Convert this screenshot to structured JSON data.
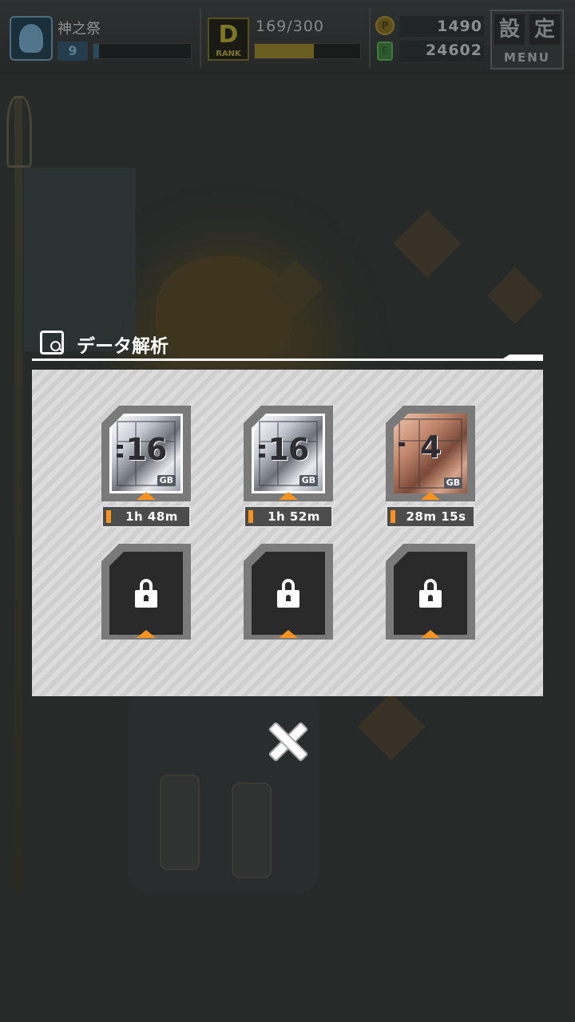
{
  "hud": {
    "player_name": "神之祭",
    "level": "9",
    "xp_fraction": 0.06,
    "rank_letter": "D",
    "rank_label": "RANK",
    "stamina_text": "169/300",
    "stamina_fraction": 0.563,
    "coins": "1490",
    "coin_icon_label": "P",
    "gems": "24602",
    "gem_icon_label": "E",
    "menu_jp_1": "設",
    "menu_jp_2": "定",
    "menu_en": "MENU"
  },
  "dialog": {
    "title": "データ解析",
    "slots": [
      {
        "type": "silver",
        "capacity": "16",
        "unit": "GB",
        "timer": "1h 48m",
        "locked": false
      },
      {
        "type": "silver",
        "capacity": "16",
        "unit": "GB",
        "timer": "1h 52m",
        "locked": false
      },
      {
        "type": "bronze",
        "capacity": "4",
        "unit": "GB",
        "timer": "28m 15s",
        "locked": false
      },
      {
        "locked": true
      },
      {
        "locked": true
      },
      {
        "locked": true
      }
    ]
  },
  "colors": {
    "accent_orange": "#f7931e",
    "panel_bg": "#d6d6d6",
    "slot_frame": "#7a7a7a"
  }
}
